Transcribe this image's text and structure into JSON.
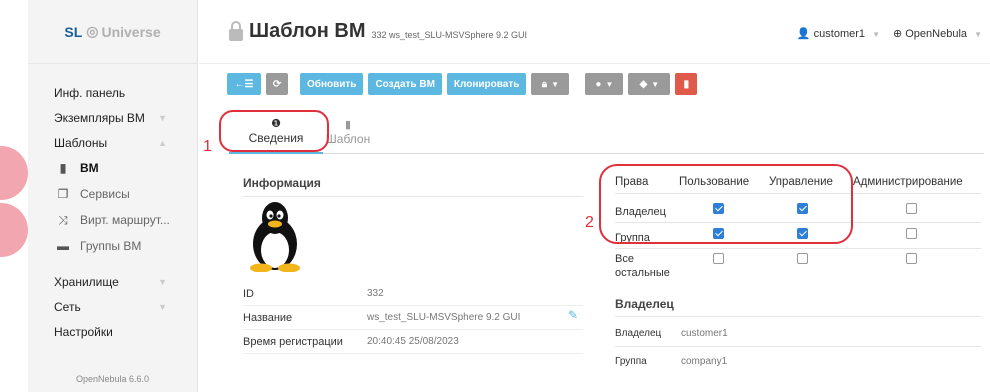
{
  "sidebar": {
    "logo_prefix": "SL",
    "logo_name": "Universe",
    "items": [
      {
        "label": "Инф. панель"
      },
      {
        "label": "Экземпляры ВМ"
      },
      {
        "label": "Шаблоны"
      }
    ],
    "subitems": [
      {
        "label": "ВМ",
        "icon": "file-icon"
      },
      {
        "label": "Сервисы",
        "icon": "copy-icon"
      },
      {
        "label": "Вирт. маршрут...",
        "icon": "shuffle-icon"
      },
      {
        "label": "Группы ВМ",
        "icon": "folder-icon"
      }
    ],
    "items2": [
      {
        "label": "Хранилище"
      },
      {
        "label": "Сеть"
      },
      {
        "label": "Настройки"
      }
    ],
    "version": "OpenNebula 6.6.0"
  },
  "header": {
    "title": "Шаблон ВМ",
    "subtitle": "332 ws_test_SLU-MSVSphere 9.2 GUI",
    "user": "customer1",
    "zone": "OpenNebula"
  },
  "toolbar": {
    "back_icon": "←☰",
    "refresh_icon": "⟳",
    "update": "Обновить",
    "create": "Создать ВМ",
    "clone": "Клонировать",
    "lock_icon": "lock-icon",
    "user_icon": "user-icon",
    "tag_icon": "tag-icon",
    "delete_icon": "trash-icon"
  },
  "tabs": {
    "info": "Сведения",
    "template": "Шаблон"
  },
  "annotations": {
    "one": "1",
    "two": "2"
  },
  "info": {
    "heading": "Информация",
    "rows": [
      {
        "key": "ID",
        "value": "332"
      },
      {
        "key": "Название",
        "value": "ws_test_SLU-MSVSphere 9.2 GUI"
      },
      {
        "key": "Время регистрации",
        "value": "20:40:45 25/08/2023"
      }
    ]
  },
  "permissions": {
    "headers": [
      "Права",
      "Пользование",
      "Управление",
      "Администрирование"
    ],
    "rows": [
      {
        "label": "Владелец",
        "use": true,
        "manage": true,
        "admin": false
      },
      {
        "label": "Группа",
        "use": true,
        "manage": true,
        "admin": false
      },
      {
        "label_line1": "Все",
        "label_line2": "остальные",
        "use": false,
        "manage": false,
        "admin": false
      }
    ]
  },
  "ownership": {
    "heading": "Владелец",
    "rows": [
      {
        "key": "Владелец",
        "value": "customer1"
      },
      {
        "key": "Группа",
        "value": "company1"
      }
    ]
  },
  "colors": {
    "accent": "#5cb8e0",
    "annotation": "#e0303c",
    "checkbox": "#2f7fd8"
  }
}
